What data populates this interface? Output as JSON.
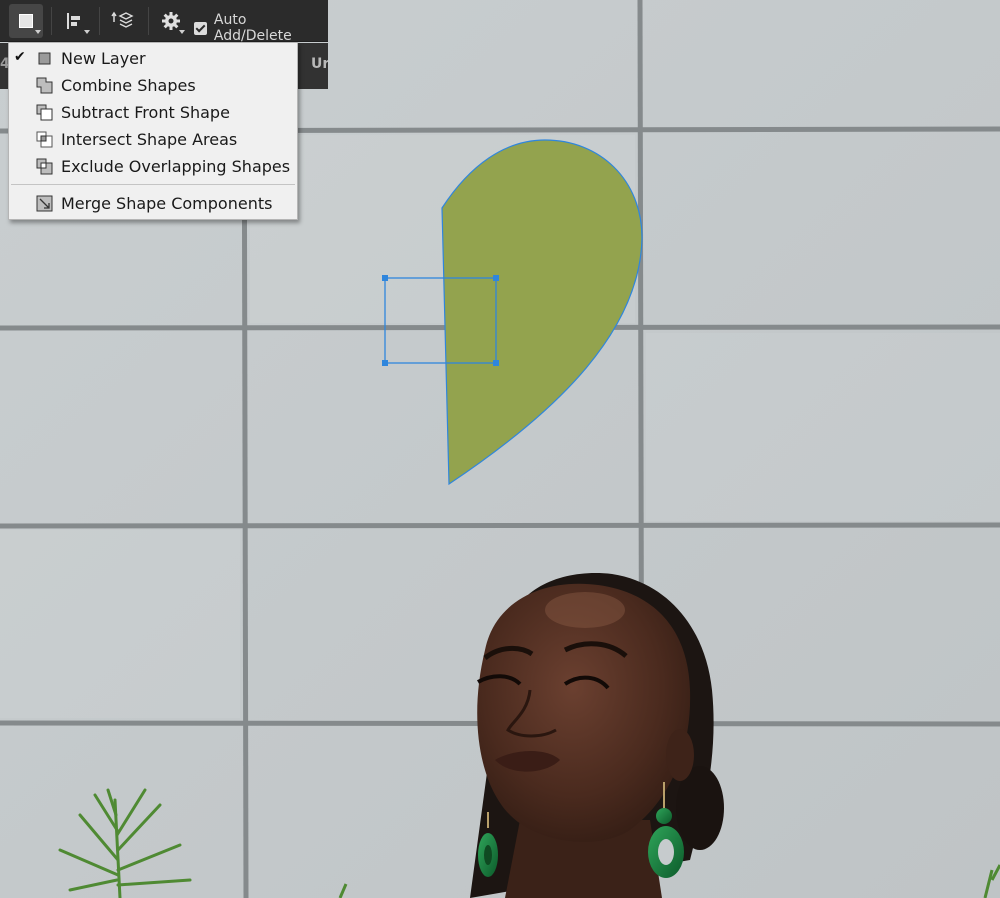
{
  "options_bar": {
    "path_operations_icon": "square-shape-icon",
    "align_icon": "path-alignment-icon",
    "arrange_icon": "path-arrangement-icon",
    "settings_icon": "gear-icon",
    "auto_add_delete": {
      "label": "Auto Add/Delete",
      "checked": true
    }
  },
  "tab_strip": {
    "left_fragment": "4",
    "right_fragment": "Ur"
  },
  "path_operations_menu": {
    "items": [
      {
        "label": "New Layer",
        "icon": "new-layer-icon",
        "checked": true
      },
      {
        "label": "Combine Shapes",
        "icon": "combine-shapes-icon",
        "checked": false
      },
      {
        "label": "Subtract Front Shape",
        "icon": "subtract-front-shape-icon",
        "checked": false
      },
      {
        "label": "Intersect Shape Areas",
        "icon": "intersect-shape-areas-icon",
        "checked": false
      },
      {
        "label": "Exclude Overlapping Shapes",
        "icon": "exclude-overlapping-shapes-icon",
        "checked": false
      },
      {
        "label": "Merge Shape Components",
        "icon": "merge-shape-components-icon",
        "checked": false
      }
    ]
  },
  "canvas": {
    "shape_fill": "#93a34e",
    "path_color": "#2f86dd",
    "wall_color": "#c6cbcd",
    "mortar_color": "#8a8f91"
  }
}
